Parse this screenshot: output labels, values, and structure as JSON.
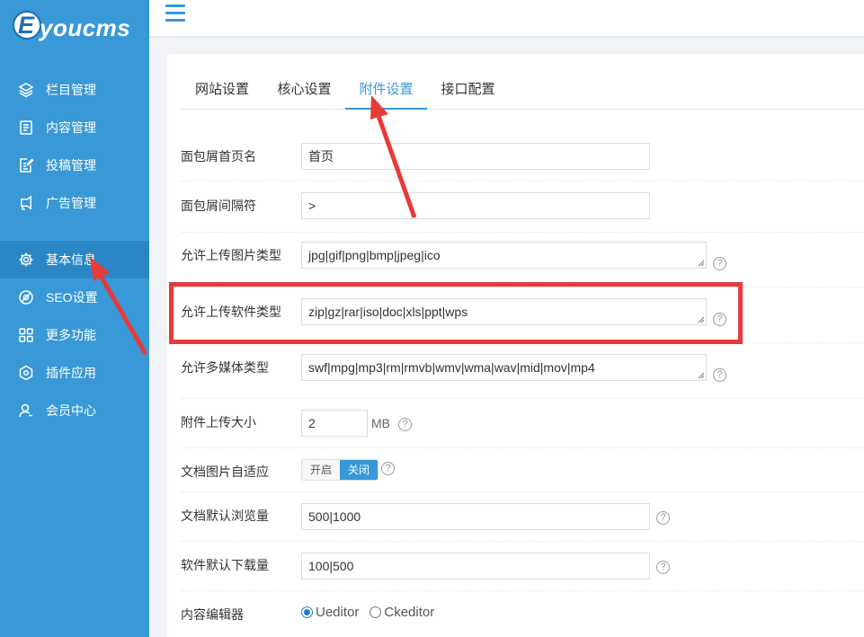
{
  "brand": {
    "logo_letter": "E",
    "logo_text": "youcms"
  },
  "sidebar": {
    "items": [
      {
        "label": "栏目管理",
        "icon": "layers-icon"
      },
      {
        "label": "内容管理",
        "icon": "document-icon"
      },
      {
        "label": "投稿管理",
        "icon": "edit-document-icon"
      },
      {
        "label": "广告管理",
        "icon": "ad-icon"
      },
      {
        "label": "基本信息",
        "icon": "gear-icon",
        "active": true
      },
      {
        "label": "SEO设置",
        "icon": "seo-icon"
      },
      {
        "label": "更多功能",
        "icon": "grid-icon"
      },
      {
        "label": "插件应用",
        "icon": "plugin-icon"
      },
      {
        "label": "会员中心",
        "icon": "user-icon"
      }
    ]
  },
  "tabs": [
    {
      "label": "网站设置"
    },
    {
      "label": "核心设置"
    },
    {
      "label": "附件设置",
      "active": true
    },
    {
      "label": "接口配置"
    }
  ],
  "form": {
    "breadcrumb_home": {
      "label": "面包屑首页名",
      "value": "首页"
    },
    "breadcrumb_sep": {
      "label": "面包屑间隔符",
      "value": ">"
    },
    "image_types": {
      "label": "允许上传图片类型",
      "value": "jpg|gif|png|bmp|jpeg|ico"
    },
    "software_types": {
      "label": "允许上传软件类型",
      "value": "zip|gz|rar|iso|doc|xls|ppt|wps"
    },
    "media_types": {
      "label": "允许多媒体类型",
      "value": "swf|mpg|mp3|rm|rmvb|wmv|wma|wav|mid|mov|mp4"
    },
    "upload_size": {
      "label": "附件上传大小",
      "value": "2",
      "unit": "MB"
    },
    "image_adapt": {
      "label": "文档图片自适应",
      "on_label": "开启",
      "off_label": "关闭",
      "selected": "关闭"
    },
    "default_views": {
      "label": "文档默认浏览量",
      "value": "500|1000"
    },
    "default_downloads": {
      "label": "软件默认下载量",
      "value": "100|500"
    },
    "editor": {
      "label": "内容编辑器",
      "options": [
        "Ueditor",
        "Ckeditor"
      ],
      "selected": "Ueditor"
    },
    "help_symbol": "?"
  },
  "colors": {
    "sidebar_bg": "#3998d6",
    "sidebar_active": "#2b86c5",
    "accent": "#3998d6",
    "annotation_red": "#e63b3b"
  }
}
